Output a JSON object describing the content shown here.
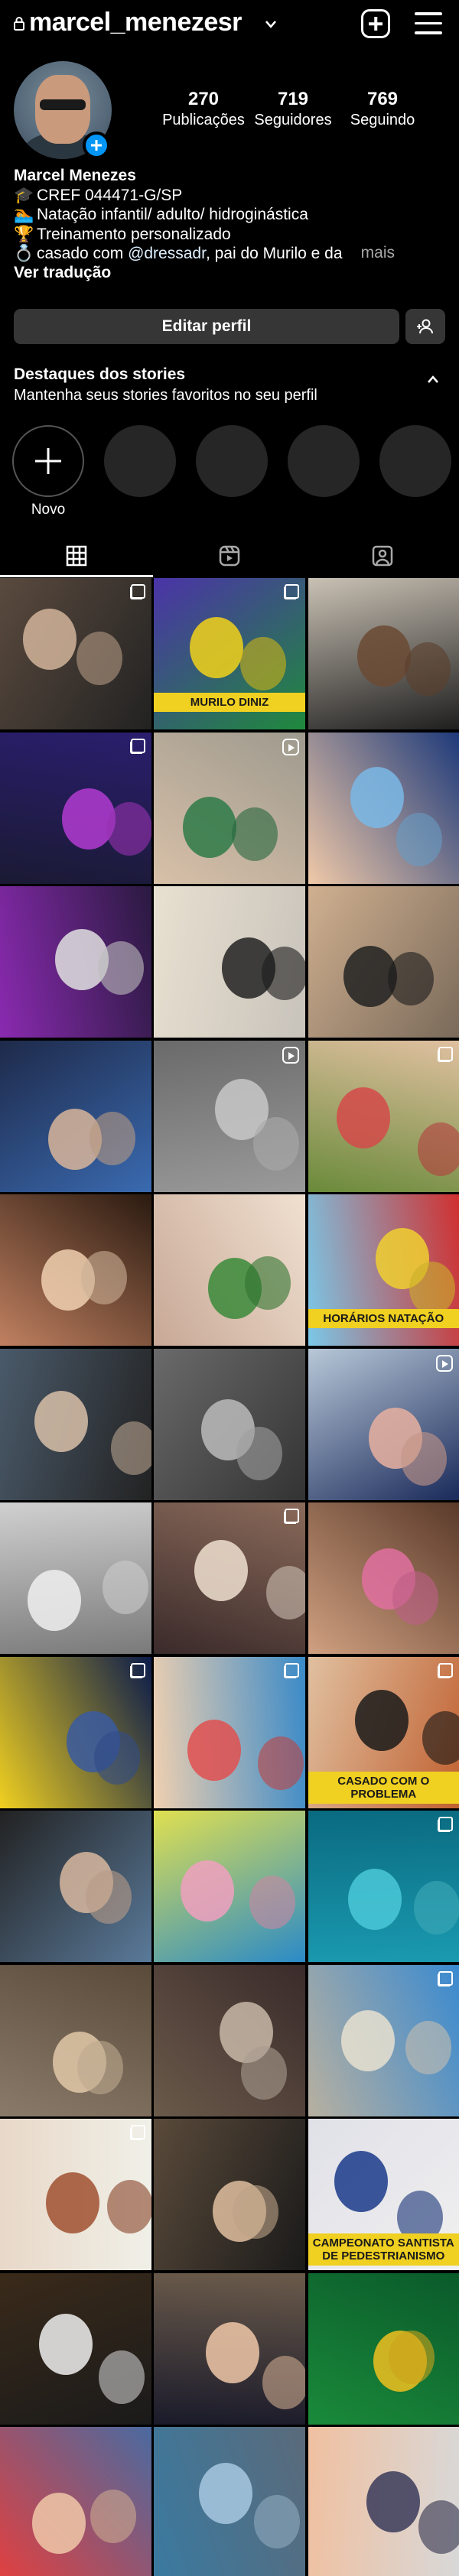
{
  "header": {
    "username": "marcel_menezesr",
    "icons": [
      "lock-icon",
      "chevron-down-icon",
      "plus-box-icon",
      "menu-icon"
    ]
  },
  "profile": {
    "stats": [
      {
        "value": "270",
        "label": "Publicações"
      },
      {
        "value": "719",
        "label": "Seguidores"
      },
      {
        "value": "769",
        "label": "Seguindo"
      }
    ],
    "name": "Marcel Menezes",
    "bio_lines": [
      {
        "icon": "🎓",
        "text": "CREF 044471-G/SP"
      },
      {
        "icon": "🏊",
        "text": "Natação infantil/ adulto/ hidroginástica"
      },
      {
        "icon": "🏆",
        "text": "Treinamento personalizado"
      }
    ],
    "bio_last": {
      "icon": "💍",
      "prefix": "casado com ",
      "mention": "@dressadr",
      "suffix": ", pai do Murilo e da"
    },
    "more_label": "mais",
    "translate_label": "Ver tradução"
  },
  "actions": {
    "edit_label": "Editar perfil"
  },
  "highlights": {
    "title": "Destaques dos stories",
    "subtitle": "Mantenha seus stories favoritos no seu perfil",
    "new_label": "Novo"
  },
  "tabs": [
    "grid-icon",
    "reels-icon",
    "tagged-icon"
  ],
  "grid": {
    "cells": [
      {
        "overlay": "multi",
        "text": ""
      },
      {
        "overlay": "multi",
        "text": "MURILO DINIZ"
      },
      {
        "overlay": "",
        "text": ""
      },
      {
        "overlay": "multi",
        "text": ""
      },
      {
        "overlay": "reel",
        "text": ""
      },
      {
        "overlay": "",
        "text": ""
      },
      {
        "overlay": "",
        "text": ""
      },
      {
        "overlay": "",
        "text": ""
      },
      {
        "overlay": "",
        "text": ""
      },
      {
        "overlay": "",
        "text": ""
      },
      {
        "overlay": "reel",
        "text": ""
      },
      {
        "overlay": "multi",
        "text": ""
      },
      {
        "overlay": "",
        "text": ""
      },
      {
        "overlay": "",
        "text": ""
      },
      {
        "overlay": "",
        "text": "HORÁRIOS NATAÇÃO"
      },
      {
        "overlay": "",
        "text": ""
      },
      {
        "overlay": "",
        "text": ""
      },
      {
        "overlay": "reel",
        "text": ""
      },
      {
        "overlay": "",
        "text": ""
      },
      {
        "overlay": "multi",
        "text": ""
      },
      {
        "overlay": "",
        "text": ""
      },
      {
        "overlay": "multi",
        "text": ""
      },
      {
        "overlay": "multi",
        "text": ""
      },
      {
        "overlay": "multi",
        "text": "CASADO COM O PROBLEMA"
      },
      {
        "overlay": "",
        "text": ""
      },
      {
        "overlay": "",
        "text": ""
      },
      {
        "overlay": "multi",
        "text": ""
      },
      {
        "overlay": "",
        "text": ""
      },
      {
        "overlay": "",
        "text": ""
      },
      {
        "overlay": "multi",
        "text": ""
      },
      {
        "overlay": "multi",
        "text": ""
      },
      {
        "overlay": "",
        "text": ""
      },
      {
        "overlay": "",
        "text": "CAMPEONATO SANTISTA DE PEDESTRIANISMO"
      },
      {
        "overlay": "",
        "text": ""
      },
      {
        "overlay": "",
        "text": ""
      },
      {
        "overlay": "",
        "text": ""
      },
      {
        "overlay": "",
        "text": ""
      },
      {
        "overlay": "",
        "text": ""
      },
      {
        "overlay": "",
        "text": ""
      }
    ]
  }
}
